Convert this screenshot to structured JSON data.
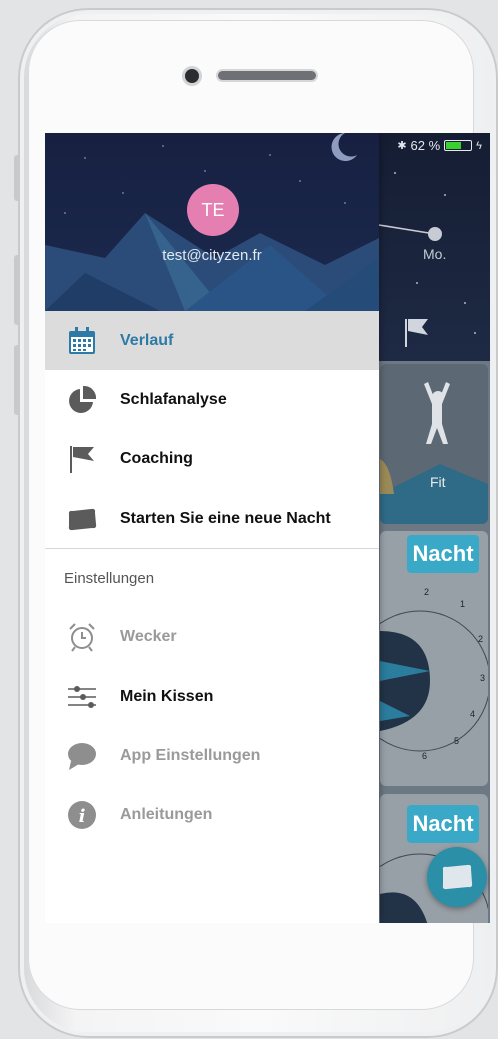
{
  "status": {
    "bluetooth": "✱",
    "battery_text": "62 %",
    "battery_level": 0.62,
    "battery_color": "#39d12e"
  },
  "drawer": {
    "avatar_initials": "TE",
    "avatar_color": "#e57fb1",
    "email": "test@cityzen.fr",
    "menu": [
      {
        "label": "Verlauf",
        "icon": "calendar-icon",
        "active": true
      },
      {
        "label": "Schlafanalyse",
        "icon": "pie-chart-icon"
      },
      {
        "label": "Coaching",
        "icon": "flag-icon"
      },
      {
        "label": "Starten Sie eine neue Nacht",
        "icon": "pillow-icon"
      }
    ],
    "settings_title": "Einstellungen",
    "settings": [
      {
        "label": "Wecker",
        "icon": "alarm-clock-icon",
        "disabled": true
      },
      {
        "label": "Mein Kissen",
        "icon": "sliders-icon"
      },
      {
        "label": "App Einstellungen",
        "icon": "chat-bubble-icon",
        "disabled": true
      },
      {
        "label": "Anleitungen",
        "icon": "info-icon",
        "disabled": true
      }
    ]
  },
  "background": {
    "day_label": "Mo.",
    "fit_label": "Fit",
    "night_label": "Nacht",
    "clock_numbers": [
      "2",
      "1",
      "2",
      "3",
      "4",
      "5",
      "6"
    ],
    "accent_color": "#3aa8c7"
  }
}
